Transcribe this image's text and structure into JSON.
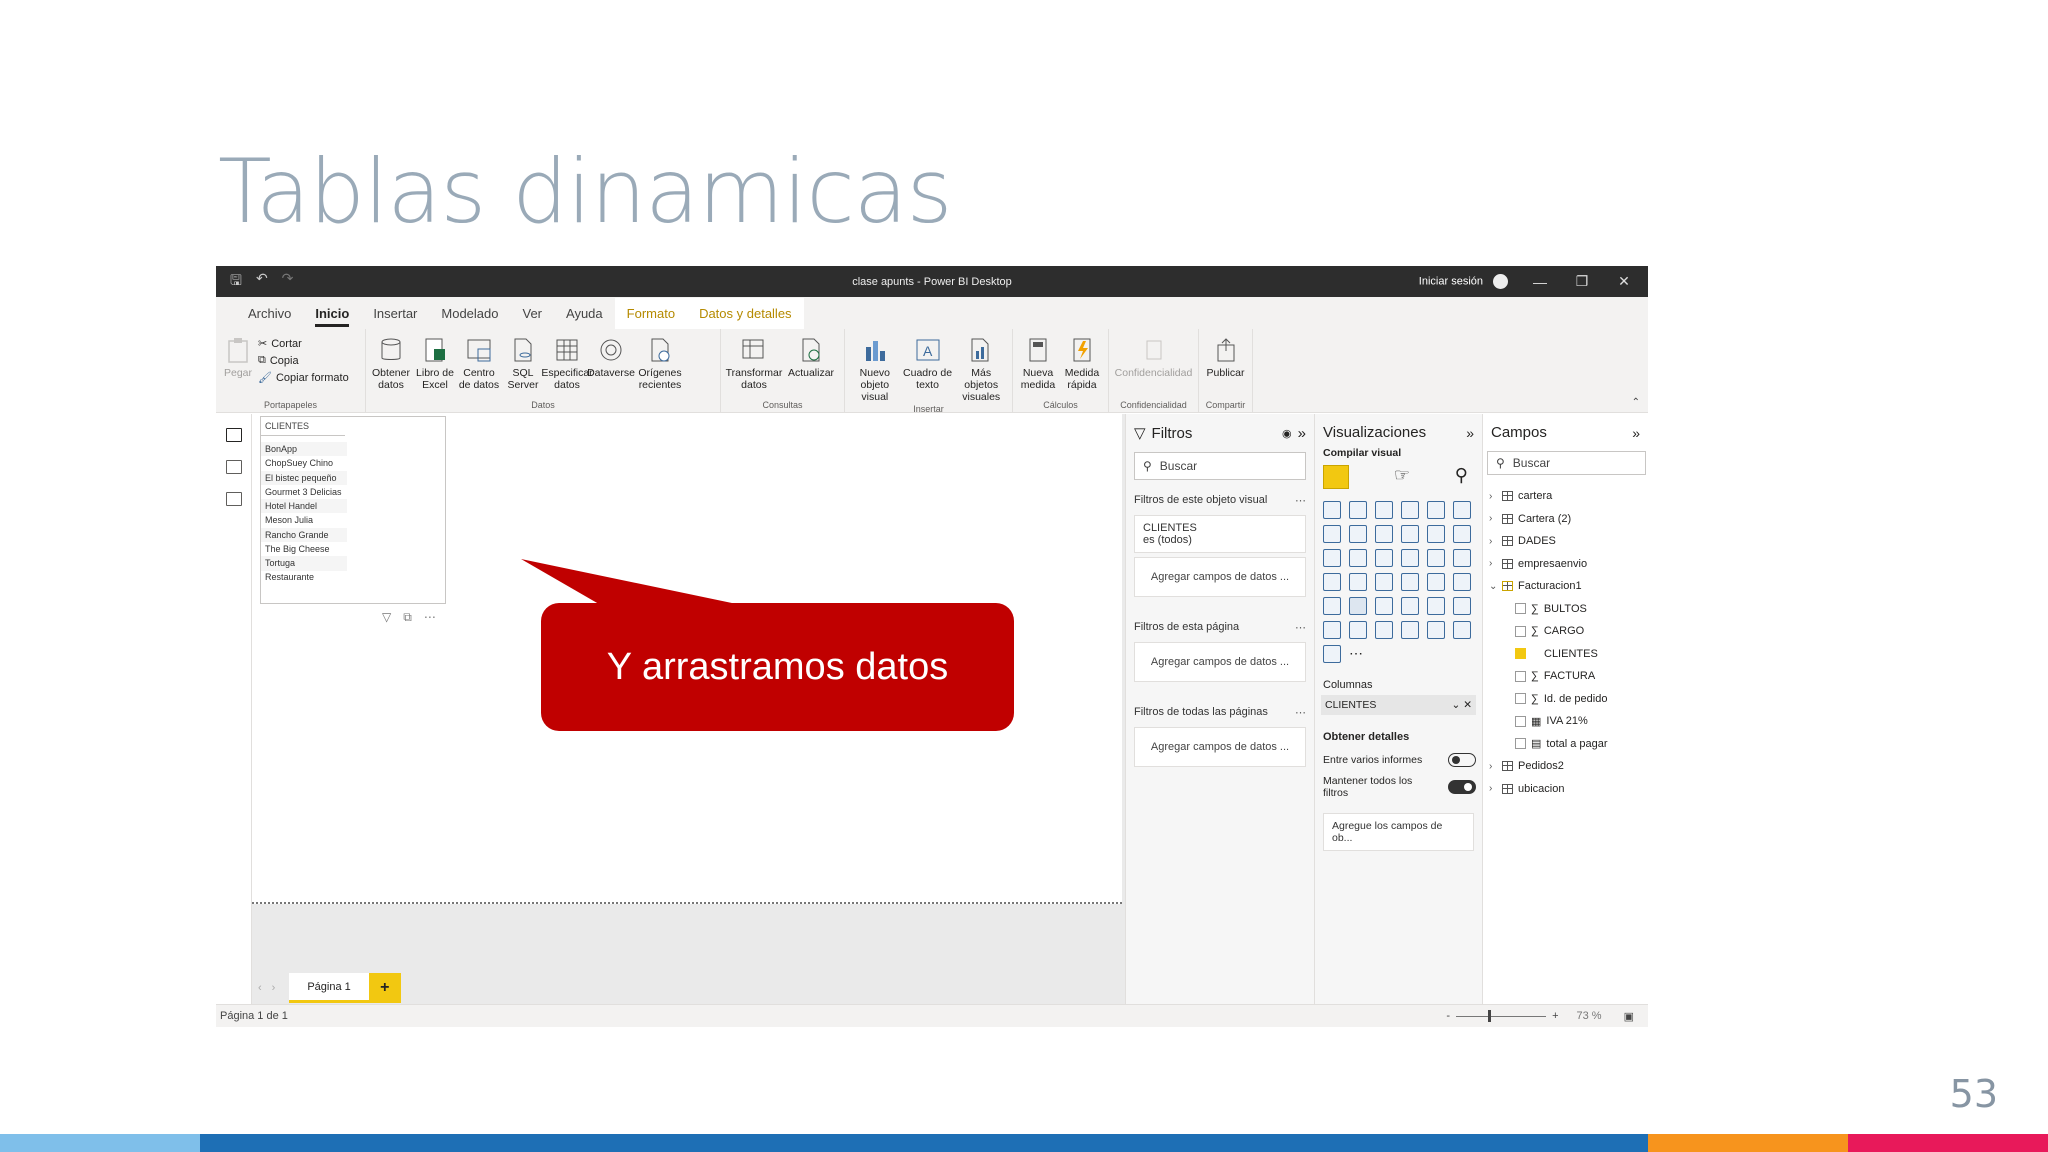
{
  "slide": {
    "title": "Tablas dinamicas",
    "page_number": "53",
    "bar_colors": [
      "#7fbfea",
      "#1e6fb5",
      "#f7941d",
      "#e8195a"
    ]
  },
  "app": {
    "window_title": "clase apunts - Power BI Desktop",
    "signin": "Iniciar sesión",
    "tabs": [
      "Archivo",
      "Inicio",
      "Insertar",
      "Modelado",
      "Ver",
      "Ayuda",
      "Formato",
      "Datos y detalles"
    ],
    "ribbon": {
      "clipboard": {
        "paste": "Pegar",
        "cut": "Cortar",
        "copy": "Copia",
        "format_painter": "Copiar formato",
        "group": "Portapapeles"
      },
      "data": {
        "items": [
          "Obtener datos",
          "Libro de Excel",
          "Centro de datos",
          "SQL Server",
          "Especificar datos",
          "Dataverse",
          "Orígenes recientes"
        ],
        "group": "Datos"
      },
      "queries": {
        "items": [
          "Transformar datos",
          "Actualizar"
        ],
        "group": "Consultas"
      },
      "insert": {
        "items": [
          "Nuevo objeto visual",
          "Cuadro de texto",
          "Más objetos visuales"
        ],
        "group": "Insertar"
      },
      "calc": {
        "items": [
          "Nueva medida",
          "Medida rápida"
        ],
        "group": "Cálculos"
      },
      "sensitivity": {
        "items": [
          "Confidencialidad"
        ],
        "group": "Confidencialidad"
      },
      "share": {
        "items": [
          "Publicar"
        ],
        "group": "Compartir"
      }
    },
    "visual": {
      "header": "CLIENTES",
      "rows": [
        "BonApp",
        "ChopSuey Chino",
        "El bistec pequeño",
        "Gourmet 3 Delicias",
        "Hotel Handel",
        "Meson Julia",
        "Rancho Grande",
        "The Big Cheese",
        "Tortuga Restaurante"
      ]
    },
    "callout": "Y arrastramos datos",
    "page_tab": "Página 1",
    "status": "Página 1 de 1",
    "zoom": "73 %",
    "filters": {
      "title": "Filtros",
      "search": "Buscar",
      "visual_section": "Filtros de este objeto visual",
      "card_field": "CLIENTES",
      "card_value": "es (todos)",
      "add": "Agregar campos de datos ...",
      "page_section": "Filtros de esta página",
      "all_section": "Filtros de todas las páginas"
    },
    "viz": {
      "title": "Visualizaciones",
      "build": "Compilar visual",
      "columns_label": "Columnas",
      "columns_value": "CLIENTES",
      "drill": "Obtener detalles",
      "cross_report": "Entre varios informes",
      "keep_filters": "Mantener todos los filtros",
      "add_drill": "Agregue los campos de ob..."
    },
    "fields": {
      "title": "Campos",
      "search": "Buscar",
      "tables": [
        {
          "name": "cartera",
          "expanded": false
        },
        {
          "name": "Cartera (2)",
          "expanded": false
        },
        {
          "name": "DADES",
          "expanded": false
        },
        {
          "name": "empresaenvio",
          "expanded": false
        },
        {
          "name": "Facturacion1",
          "expanded": true
        }
      ],
      "facturacion_fields": [
        {
          "name": "BULTOS",
          "sigma": true,
          "checked": false
        },
        {
          "name": "CARGO",
          "sigma": true,
          "checked": false
        },
        {
          "name": "CLIENTES",
          "sigma": false,
          "checked": true
        },
        {
          "name": "FACTURA",
          "sigma": true,
          "checked": false
        },
        {
          "name": "Id. de pedido",
          "sigma": true,
          "checked": false
        },
        {
          "name": "IVA 21%",
          "sigma": false,
          "checked": false
        },
        {
          "name": "total a pagar",
          "sigma": false,
          "checked": false
        }
      ],
      "tables_after": [
        "Pedidos2",
        "ubicacion"
      ]
    }
  }
}
